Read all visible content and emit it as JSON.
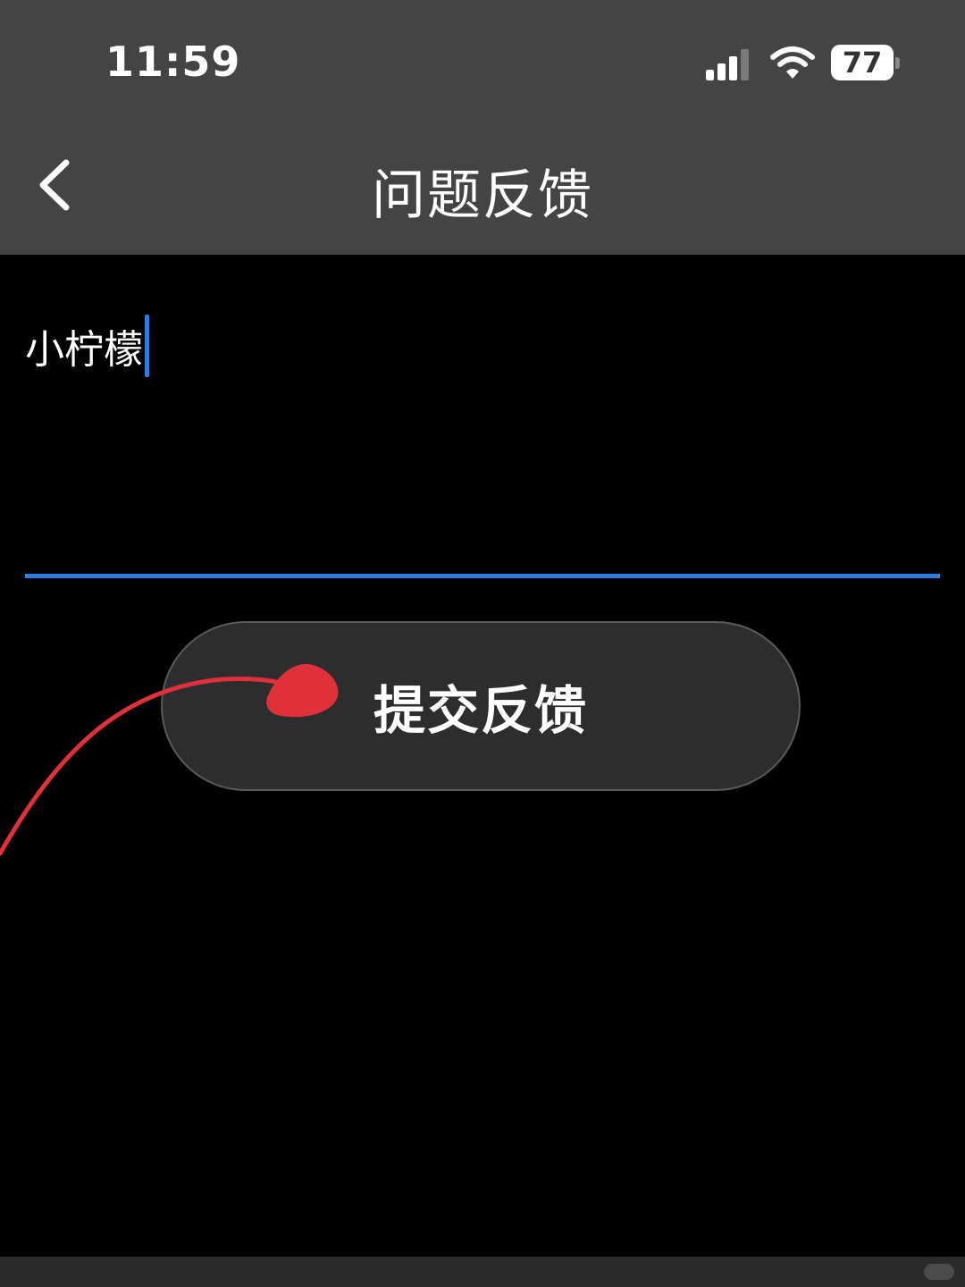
{
  "status_bar": {
    "time": "11:59",
    "battery_level": "77",
    "signal_icon": "cellular-signal-icon",
    "wifi_icon": "wifi-icon",
    "battery_icon": "battery-icon"
  },
  "nav": {
    "back_icon": "chevron-left-icon",
    "title": "问题反馈"
  },
  "feedback": {
    "value": "小柠檬",
    "accent_color": "#2f7de0"
  },
  "submit": {
    "label": "提交反馈"
  },
  "colors": {
    "header_bg": "#444444",
    "page_bg": "#000000",
    "button_bg": "#2d2d2d",
    "annotation": "#e0303a"
  }
}
